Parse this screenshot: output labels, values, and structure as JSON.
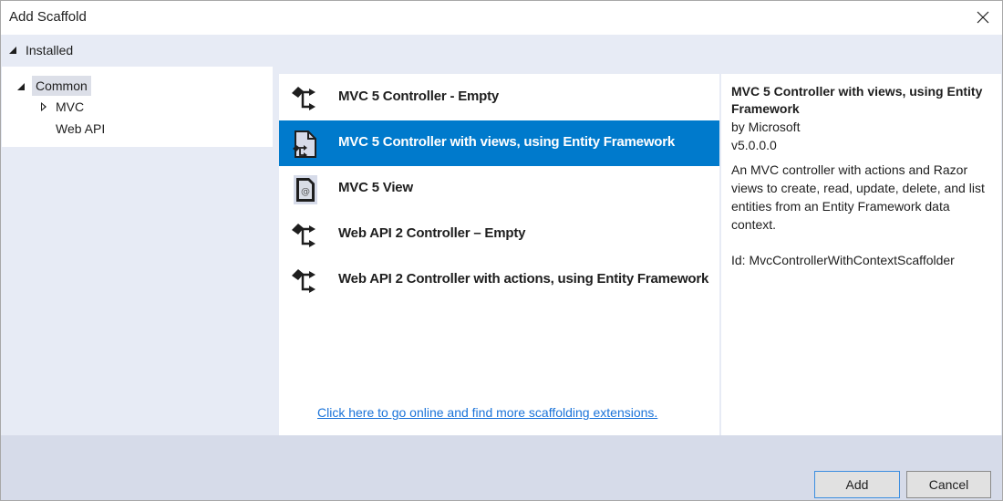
{
  "window": {
    "title": "Add Scaffold",
    "close_icon": "close-icon"
  },
  "category_header": {
    "label": "Installed",
    "expanded": true
  },
  "tree": {
    "items": [
      {
        "label": "Common",
        "expanded": true,
        "selected": true
      },
      {
        "label": "MVC",
        "expanded": false,
        "selected": false
      },
      {
        "label": "Web API",
        "selected": false
      }
    ]
  },
  "scaffolds": {
    "items": [
      {
        "label": "MVC 5 Controller - Empty",
        "icon": "controller-icon",
        "selected": false
      },
      {
        "label": "MVC 5 Controller with views, using Entity Framework",
        "icon": "controller-views-icon",
        "selected": true
      },
      {
        "label": "MVC 5 View",
        "icon": "view-file-icon",
        "selected": false
      },
      {
        "label": "Web API 2 Controller – Empty",
        "icon": "controller-icon",
        "selected": false
      },
      {
        "label": "Web API 2 Controller with actions, using Entity Framework",
        "icon": "controller-icon",
        "selected": false
      }
    ],
    "online_link": "Click here to go online and find more scaffolding extensions."
  },
  "details": {
    "title": "MVC 5 Controller with views, using Entity Framework",
    "author": "by Microsoft",
    "version": "v5.0.0.0",
    "description": "An MVC controller with actions and Razor views to create, read, update, delete, and list entities from an Entity Framework data context.",
    "id": "Id: MvcControllerWithContextScaffolder"
  },
  "footer": {
    "add_label": "Add",
    "cancel_label": "Cancel"
  },
  "colors": {
    "selection": "#007acc",
    "link": "#1a73d9",
    "panel_bg": "#e7ebf5",
    "footer_bg": "#d6dbe9"
  }
}
